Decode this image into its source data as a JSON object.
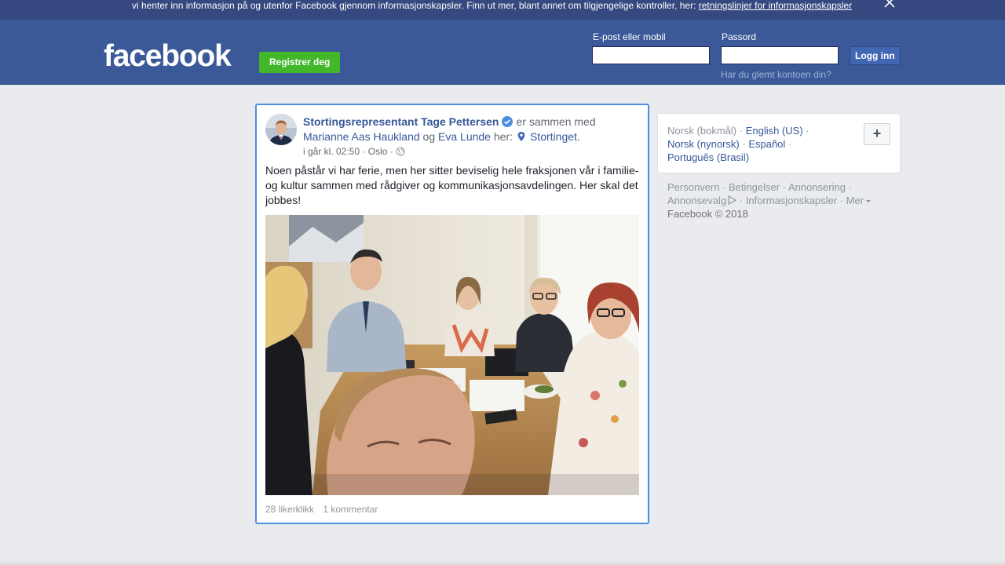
{
  "cookie_banner": {
    "text": "vi henter inn informasjon på og utenfor Facebook gjennom informasjonskapsler. Finn ut mer, blant annet om tilgjengelige kontroller, her: ",
    "link": "retningslinjer for informasjonskapsler",
    "close_icon": "close-icon"
  },
  "header": {
    "logo": "facebook",
    "register_label": "Registrer deg",
    "email_label": "E-post eller mobil",
    "email_value": "",
    "password_label": "Passord",
    "password_value": "",
    "login_label": "Logg inn",
    "forgot_label": "Har du glemt kontoen din?"
  },
  "post": {
    "author": "Stortingsrepresentant Tage Pettersen",
    "with_text": "er sammen med",
    "tagged_1": "Marianne Aas Haukland",
    "and_text": "og",
    "tagged_2": "Eva Lunde",
    "here_text": "her:",
    "place": "Stortinget",
    "place_suffix": ".",
    "time": "i går kl. 02:50",
    "location": "Oslo",
    "body": "Noen påstår vi har ferie, men her sitter beviselig hele fraksjonen vår i familie- og kultur sammen med rådgiver og kommunikasjonsavdelingen. Her skal det jobbes!",
    "likes": "28 likerklikk",
    "comments": "1 kommentar"
  },
  "languages": {
    "current": "Norsk (bokmål)",
    "options": [
      "English (US)",
      "Norsk (nynorsk)",
      "Español",
      "Português (Brasil)"
    ],
    "add_label": "+"
  },
  "footer": {
    "links": [
      "Personvern",
      "Betingelser",
      "Annonsering",
      "Annonsevalg",
      "Informasjonskapsler",
      "Mer"
    ],
    "copyright": "Facebook © 2018"
  },
  "colors": {
    "header_bg": "#3b5998",
    "banner_bg": "#35487f",
    "register_green": "#42b72a",
    "link_blue": "#365899",
    "verified_blue": "#4a90e2"
  }
}
